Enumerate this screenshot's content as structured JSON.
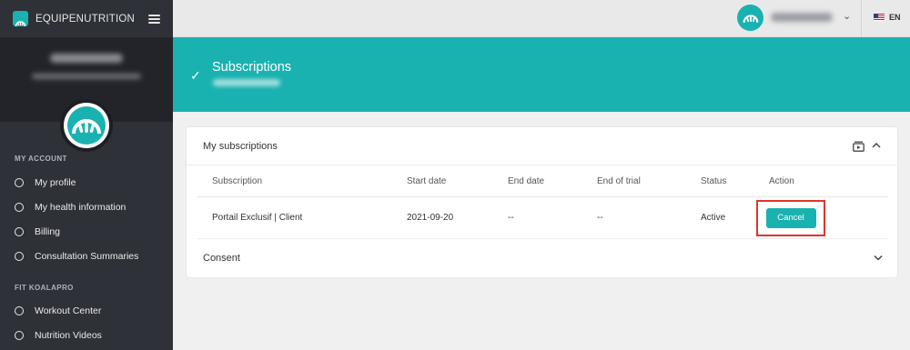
{
  "app": {
    "brand": "EQUIPENUTRITION",
    "accent": "#1ab2b0",
    "sidebar_bg": "#2f3138",
    "highlight": "#e0342b"
  },
  "sidebar": {
    "sections": [
      {
        "label": "MY ACCOUNT",
        "items": [
          "My profile",
          "My health information",
          "Billing",
          "Consultation Summaries"
        ]
      },
      {
        "label": "FIT KOALAPRO",
        "items": [
          "Workout Center",
          "Nutrition Videos"
        ]
      }
    ]
  },
  "topbar": {
    "language": "EN",
    "caret": "⌄"
  },
  "banner": {
    "title": "Subscriptions",
    "icon": "check-icon"
  },
  "card": {
    "title": "My subscriptions",
    "columns": [
      "Subscription",
      "Start date",
      "End date",
      "End of trial",
      "Status",
      "Action"
    ],
    "rows": [
      {
        "subscription": "Portail Exclusif | Client",
        "start_date": "2021-09-20",
        "end_date": "--",
        "end_of_trial": "--",
        "status": "Active",
        "action": "Cancel"
      }
    ]
  },
  "consent": {
    "title": "Consent"
  }
}
